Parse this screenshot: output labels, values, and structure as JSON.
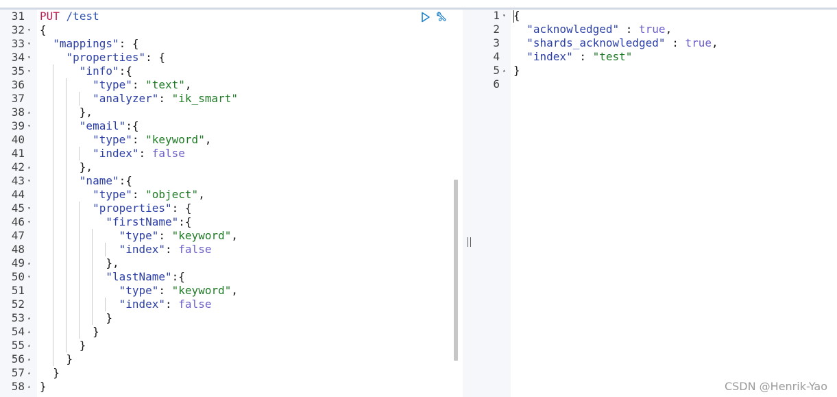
{
  "request": {
    "method": "PUT",
    "path": "/test",
    "lines": [
      {
        "n": "31",
        "fold": "",
        "html": "<span class='method'>PUT</span> <span class='path'>/test</span>"
      },
      {
        "n": "32",
        "fold": "▾",
        "html": "<span class='punct'>{</span>"
      },
      {
        "n": "33",
        "fold": "▾",
        "html": "  <span class='key'>\"mappings\"</span><span class='punct'>: {</span>"
      },
      {
        "n": "34",
        "fold": "▾",
        "html": "    <span class='key'>\"properties\"</span><span class='punct'>: {</span>"
      },
      {
        "n": "35",
        "fold": "▾",
        "html": "      <span class='key'>\"info\"</span><span class='punct'>:{</span>"
      },
      {
        "n": "36",
        "fold": "",
        "html": "        <span class='key'>\"type\"</span><span class='punct'>: </span><span class='str'>\"text\"</span><span class='punct'>,</span>"
      },
      {
        "n": "37",
        "fold": "",
        "html": "        <span class='key'>\"analyzer\"</span><span class='punct'>: </span><span class='str'>\"ik_smart\"</span>"
      },
      {
        "n": "38",
        "fold": "▴",
        "html": "      <span class='punct'>},</span>"
      },
      {
        "n": "39",
        "fold": "▾",
        "html": "      <span class='key'>\"email\"</span><span class='punct'>:{</span>"
      },
      {
        "n": "40",
        "fold": "",
        "html": "        <span class='key'>\"type\"</span><span class='punct'>: </span><span class='str'>\"keyword\"</span><span class='punct'>,</span>"
      },
      {
        "n": "41",
        "fold": "",
        "html": "        <span class='key'>\"index\"</span><span class='punct'>: </span><span class='bool'>false</span>"
      },
      {
        "n": "42",
        "fold": "▴",
        "html": "      <span class='punct'>},</span>"
      },
      {
        "n": "43",
        "fold": "▾",
        "html": "      <span class='key'>\"name\"</span><span class='punct'>:{</span>"
      },
      {
        "n": "44",
        "fold": "",
        "html": "        <span class='key'>\"type\"</span><span class='punct'>: </span><span class='str'>\"object\"</span><span class='punct'>,</span>"
      },
      {
        "n": "45",
        "fold": "▾",
        "html": "        <span class='key'>\"properties\"</span><span class='punct'>: {</span>"
      },
      {
        "n": "46",
        "fold": "▾",
        "html": "          <span class='key'>\"firstName\"</span><span class='punct'>:{</span>"
      },
      {
        "n": "47",
        "fold": "",
        "html": "            <span class='key'>\"type\"</span><span class='punct'>: </span><span class='str'>\"keyword\"</span><span class='punct'>,</span>"
      },
      {
        "n": "48",
        "fold": "",
        "html": "            <span class='key'>\"index\"</span><span class='punct'>: </span><span class='bool'>false</span>"
      },
      {
        "n": "49",
        "fold": "▴",
        "html": "          <span class='punct'>},</span>"
      },
      {
        "n": "50",
        "fold": "▾",
        "html": "          <span class='key'>\"lastName\"</span><span class='punct'>:{</span>"
      },
      {
        "n": "51",
        "fold": "",
        "html": "            <span class='key'>\"type\"</span><span class='punct'>: </span><span class='str'>\"keyword\"</span><span class='punct'>,</span>"
      },
      {
        "n": "52",
        "fold": "",
        "html": "            <span class='key'>\"index\"</span><span class='punct'>: </span><span class='bool'>false</span>"
      },
      {
        "n": "53",
        "fold": "▴",
        "html": "          <span class='punct'>}</span>"
      },
      {
        "n": "54",
        "fold": "▴",
        "html": "        <span class='punct'>}</span>"
      },
      {
        "n": "55",
        "fold": "▴",
        "html": "      <span class='punct'>}</span>"
      },
      {
        "n": "56",
        "fold": "▴",
        "html": "    <span class='punct'>}</span>"
      },
      {
        "n": "57",
        "fold": "▴",
        "html": "  <span class='punct'>}</span>"
      },
      {
        "n": "58",
        "fold": "▴",
        "html": "<span class='punct'>}</span>"
      }
    ]
  },
  "response": {
    "lines": [
      {
        "n": "1",
        "fold": "▾",
        "html": "<span class='punct'>{</span>"
      },
      {
        "n": "2",
        "fold": "",
        "html": "  <span class='key'>\"acknowledged\"</span><span class='punct'> : </span><span class='bool'>true</span><span class='punct'>,</span>"
      },
      {
        "n": "3",
        "fold": "",
        "html": "  <span class='key'>\"shards_acknowledged\"</span><span class='punct'> : </span><span class='bool'>true</span><span class='punct'>,</span>"
      },
      {
        "n": "4",
        "fold": "",
        "html": "  <span class='key'>\"index\"</span><span class='punct'> : </span><span class='str'>\"test\"</span>"
      },
      {
        "n": "5",
        "fold": "▴",
        "html": "<span class='punct'>}</span>"
      },
      {
        "n": "6",
        "fold": "",
        "html": ""
      }
    ]
  },
  "actions": {
    "run_icon": "play-icon",
    "settings_icon": "wrench-icon"
  },
  "watermark": "CSDN @Henrik-Yao",
  "colors": {
    "key": "#2c3fa6",
    "string": "#1e7a24",
    "boolean": "#6a5ec8",
    "method": "#bd1e50",
    "accent": "#1a7fc9"
  }
}
